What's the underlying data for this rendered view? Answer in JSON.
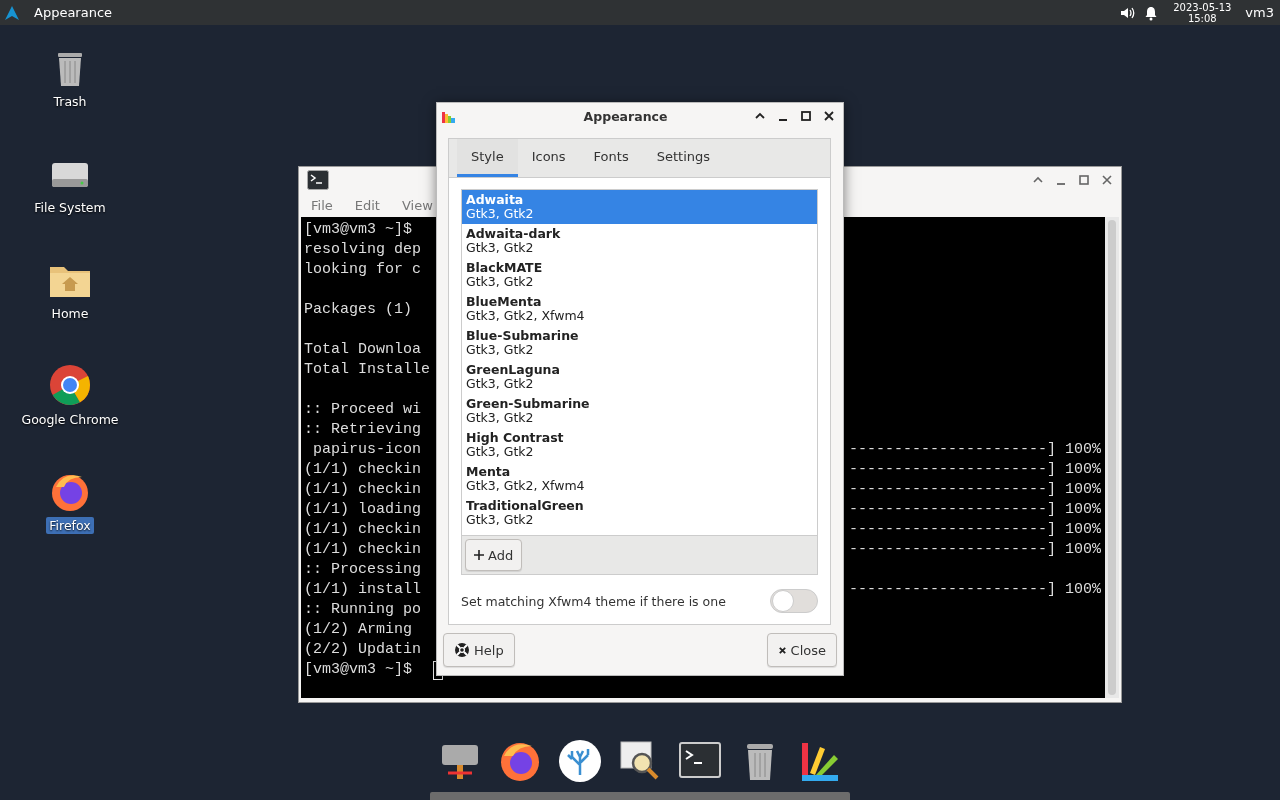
{
  "top_panel": {
    "app_title": "Appearance",
    "date": "2023-05-13",
    "time": "15:08",
    "user": "vm3"
  },
  "desktop_icons": [
    {
      "label": "Trash",
      "kind": "trash",
      "selected": false
    },
    {
      "label": "File System",
      "kind": "drive",
      "selected": false
    },
    {
      "label": "Home",
      "kind": "folder",
      "selected": false
    },
    {
      "label": "Google Chrome",
      "kind": "chrome",
      "selected": false
    },
    {
      "label": "Firefox",
      "kind": "firefox",
      "selected": true
    }
  ],
  "terminal": {
    "menu": [
      "File",
      "Edit",
      "View"
    ],
    "blocks": [
      {
        "lines": [
          {
            "left": "[vm3@vm3 ~]$"
          },
          {
            "left": "resolving dep"
          },
          {
            "left": "looking for c"
          }
        ]
      },
      {
        "lines": [
          {
            "left": "Packages (1)"
          }
        ]
      },
      {
        "lines": [
          {
            "left": "Total Downloa"
          },
          {
            "left": "Total Installe"
          }
        ]
      },
      {
        "lines": [
          {
            "left": ":: Proceed wi"
          },
          {
            "left": ":: Retrieving"
          },
          {
            "left": " papirus-icon",
            "right": "----------------------] 100%"
          },
          {
            "left": "(1/1) checkin",
            "right": "----------------------] 100%"
          },
          {
            "left": "(1/1) checkin",
            "right": "----------------------] 100%"
          },
          {
            "left": "(1/1) loading",
            "right": "----------------------] 100%"
          },
          {
            "left": "(1/1) checkin",
            "right": "----------------------] 100%"
          },
          {
            "left": "(1/1) checkin",
            "right": "----------------------] 100%"
          },
          {
            "left": ":: Processing"
          },
          {
            "left": "(1/1) install",
            "right": "----------------------] 100%"
          },
          {
            "left": ":: Running po"
          },
          {
            "left": "(1/2) Arming"
          },
          {
            "left": "(2/2) Updatin"
          },
          {
            "left": "[vm3@vm3 ~]$"
          }
        ]
      }
    ]
  },
  "dialog": {
    "title": "Appearance",
    "tabs": [
      {
        "label": "Style",
        "selected": true
      },
      {
        "label": "Icons",
        "selected": false
      },
      {
        "label": "Fonts",
        "selected": false
      },
      {
        "label": "Settings",
        "selected": false
      }
    ],
    "themes": [
      {
        "name": "Adwaita",
        "engines": "Gtk3, Gtk2",
        "selected": true
      },
      {
        "name": "Adwaita-dark",
        "engines": "Gtk3, Gtk2",
        "selected": false
      },
      {
        "name": "BlackMATE",
        "engines": "Gtk3, Gtk2",
        "selected": false
      },
      {
        "name": "BlueMenta",
        "engines": "Gtk3, Gtk2, Xfwm4",
        "selected": false
      },
      {
        "name": "Blue-Submarine",
        "engines": "Gtk3, Gtk2",
        "selected": false
      },
      {
        "name": "GreenLaguna",
        "engines": "Gtk3, Gtk2",
        "selected": false
      },
      {
        "name": "Green-Submarine",
        "engines": "Gtk3, Gtk2",
        "selected": false
      },
      {
        "name": "High Contrast",
        "engines": "Gtk3, Gtk2",
        "selected": false
      },
      {
        "name": "Menta",
        "engines": "Gtk3, Gtk2, Xfwm4",
        "selected": false
      },
      {
        "name": "TraditionalGreen",
        "engines": "Gtk3, Gtk2",
        "selected": false
      }
    ],
    "add_button": "Add",
    "option": {
      "label": "Set matching Xfwm4 theme if there is one",
      "on": false
    },
    "help_button": "Help",
    "close_button": "Close"
  },
  "dock": [
    {
      "kind": "network"
    },
    {
      "kind": "firefox"
    },
    {
      "kind": "coral"
    },
    {
      "kind": "viewer"
    },
    {
      "kind": "terminal"
    },
    {
      "kind": "trash"
    },
    {
      "kind": "palette"
    }
  ]
}
